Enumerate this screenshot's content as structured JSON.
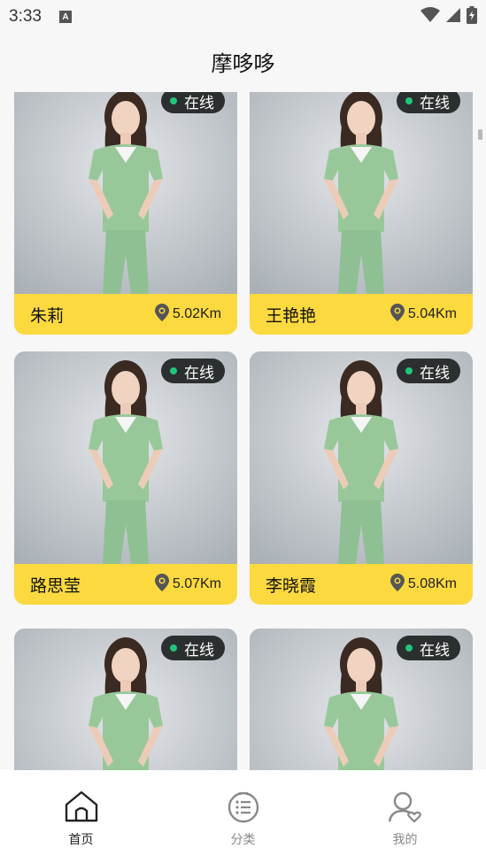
{
  "status_bar": {
    "time": "3:33",
    "notification_icon": "A"
  },
  "header": {
    "title": "摩哆哆"
  },
  "cards": [
    {
      "name": "朱莉",
      "distance": "5.02Km",
      "status": "在线"
    },
    {
      "name": "王艳艳",
      "distance": "5.04Km",
      "status": "在线"
    },
    {
      "name": "路思莹",
      "distance": "5.07Km",
      "status": "在线"
    },
    {
      "name": "李晓霞",
      "distance": "5.08Km",
      "status": "在线"
    },
    {
      "status": "在线"
    },
    {
      "status": "在线"
    }
  ],
  "tabbar": {
    "items": [
      {
        "label": "首页",
        "icon": "home-icon",
        "active": true
      },
      {
        "label": "分类",
        "icon": "category-icon",
        "active": false
      },
      {
        "label": "我的",
        "icon": "profile-icon",
        "active": false
      }
    ]
  },
  "colors": {
    "accent_yellow": "#fcd93f",
    "online_dot": "#1ec77a",
    "uniform_green": "#98c89a",
    "tab_active": "#222222",
    "tab_inactive": "#888888"
  }
}
